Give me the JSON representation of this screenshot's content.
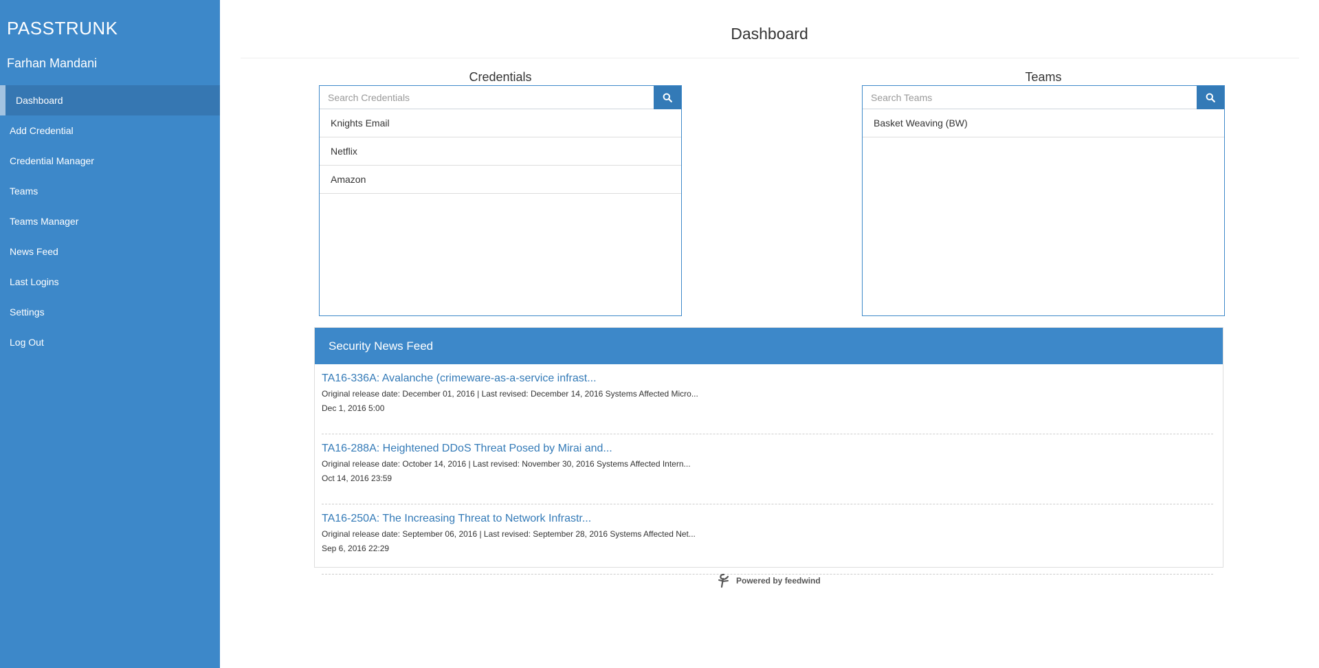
{
  "sidebar": {
    "brand": "PASSTRUNK",
    "user": "Farhan Mandani",
    "items": [
      {
        "label": "Dashboard"
      },
      {
        "label": "Add Credential"
      },
      {
        "label": "Credential Manager"
      },
      {
        "label": "Teams"
      },
      {
        "label": "Teams Manager"
      },
      {
        "label": "News Feed"
      },
      {
        "label": "Last Logins"
      },
      {
        "label": "Settings"
      },
      {
        "label": "Log Out"
      }
    ]
  },
  "page": {
    "title": "Dashboard"
  },
  "credentials": {
    "title": "Credentials",
    "placeholder": "Search Credentials",
    "items": [
      "Knights Email",
      "Netflix",
      "Amazon"
    ]
  },
  "teams": {
    "title": "Teams",
    "placeholder": "Search Teams",
    "items": [
      "Basket Weaving (BW)"
    ]
  },
  "news": {
    "header": "Security News Feed",
    "items": [
      {
        "title": "TA16-336A: Avalanche (crimeware-as-a-service infrast...",
        "desc": "Original release date: December 01, 2016 | Last revised: December 14, 2016 Systems Affected Micro...",
        "date": "Dec 1, 2016 5:00"
      },
      {
        "title": "TA16-288A: Heightened DDoS Threat Posed by Mirai and...",
        "desc": "Original release date: October 14, 2016 | Last revised: November 30, 2016 Systems Affected Intern...",
        "date": "Oct 14, 2016 23:59"
      },
      {
        "title": "TA16-250A: The Increasing Threat to Network Infrastr...",
        "desc": "Original release date: September 06, 2016 | Last revised: September 28, 2016 Systems Affected Net...",
        "date": "Sep 6, 2016 22:29"
      }
    ],
    "powered_by": "Powered by feedwind"
  },
  "colors": {
    "sidebar": "#3d88c9",
    "sidebar_active": "#3677b2",
    "accent": "#337ab7"
  },
  "icons": {
    "search": "search-icon",
    "feedwind": "feedwind-logo-icon"
  }
}
